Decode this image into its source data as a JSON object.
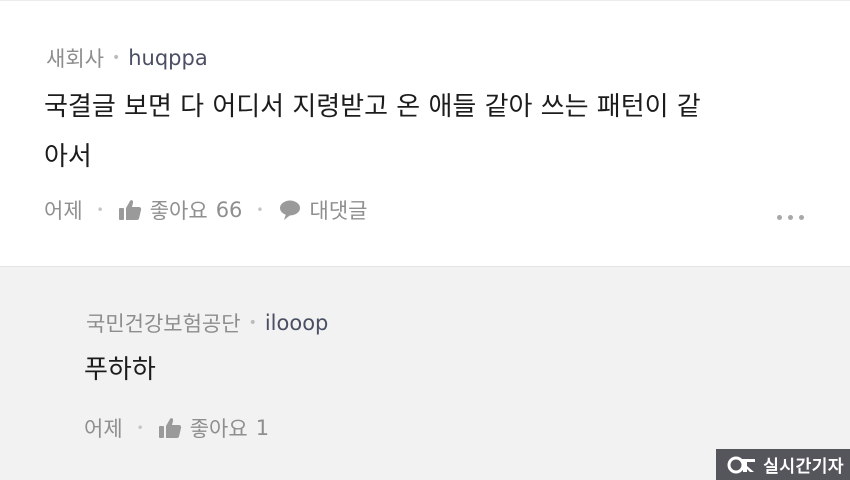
{
  "comment": {
    "org": "새회사",
    "username": "huqppa",
    "text_line1": "국결글 보면 다 어디서 지령받고 온 애들 같아 쓰는 패턴이 같",
    "text_line2": "아서",
    "time": "어제",
    "like_label": "좋아요",
    "like_count": "66",
    "reply_label": "대댓글",
    "more_icon": "more-dots-icon"
  },
  "reply": {
    "org": "국민건강보험공단",
    "username": "ilooop",
    "text": "푸하하",
    "time": "어제",
    "like_label": "좋아요",
    "like_count": "1"
  },
  "watermark": {
    "text": "실시간기자"
  },
  "icons": {
    "like": "thumbs-up-icon",
    "reply": "speech-bubble-icon"
  },
  "colors": {
    "reply_bg": "#f2f2f3",
    "meta_gray": "#8d8d8d",
    "username": "#4a4f63",
    "body_text": "#1c1c1c",
    "watermark_bg": "#55565c"
  }
}
